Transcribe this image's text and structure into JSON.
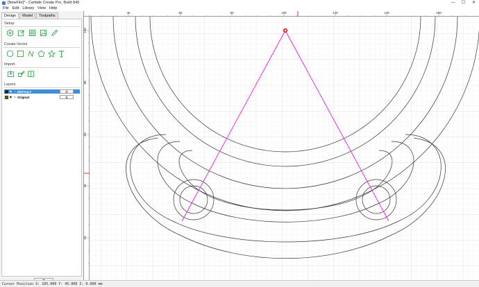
{
  "window": {
    "title": "[NewFile]* - Carbide Create Pro, Build 845",
    "minimize": "—",
    "maximize": "☐",
    "close": "✕"
  },
  "menu": [
    "File",
    "Edit",
    "Library",
    "View",
    "Help"
  ],
  "tabs": [
    "Design",
    "Model",
    "Toolpaths"
  ],
  "sections": {
    "setup": "Setup",
    "create_vector": "Create Vector",
    "import": "Import",
    "layers": "Layers"
  },
  "layers": [
    {
      "name": "DEFAULT",
      "color": "#1a1a1a",
      "selected": true
    },
    {
      "name": "Original",
      "color": "#6b6b0a",
      "selected": false
    }
  ],
  "layer_gear": "⚙",
  "add_layer_label": "+",
  "ruler": {
    "x_ticks": [
      "40",
      "60",
      "80",
      "100",
      "120",
      "140",
      "160"
    ],
    "y_ticks": [
      "100",
      "80",
      "60",
      "40",
      "20"
    ]
  },
  "status": {
    "text": "Cursor Position X: 105.000 Y: 45.000 Z: 0.000 mm"
  },
  "colors": {
    "accent": "#3c8fd6",
    "toolIcon": "#3aa64a",
    "guide": "#ff00ff",
    "marker": "#e03030"
  },
  "icons": [
    "app-icon",
    "job-setup-icon",
    "edit-icon",
    "grid-icon",
    "image-icon",
    "pencil-icon",
    "circle-icon",
    "rectangle-icon",
    "curve-icon",
    "polygon-icon",
    "star-icon",
    "text-icon",
    "import-vector-icon",
    "import-bitmap-icon",
    "import-model-icon",
    "eye-icon",
    "lock-icon",
    "gear-icon"
  ]
}
